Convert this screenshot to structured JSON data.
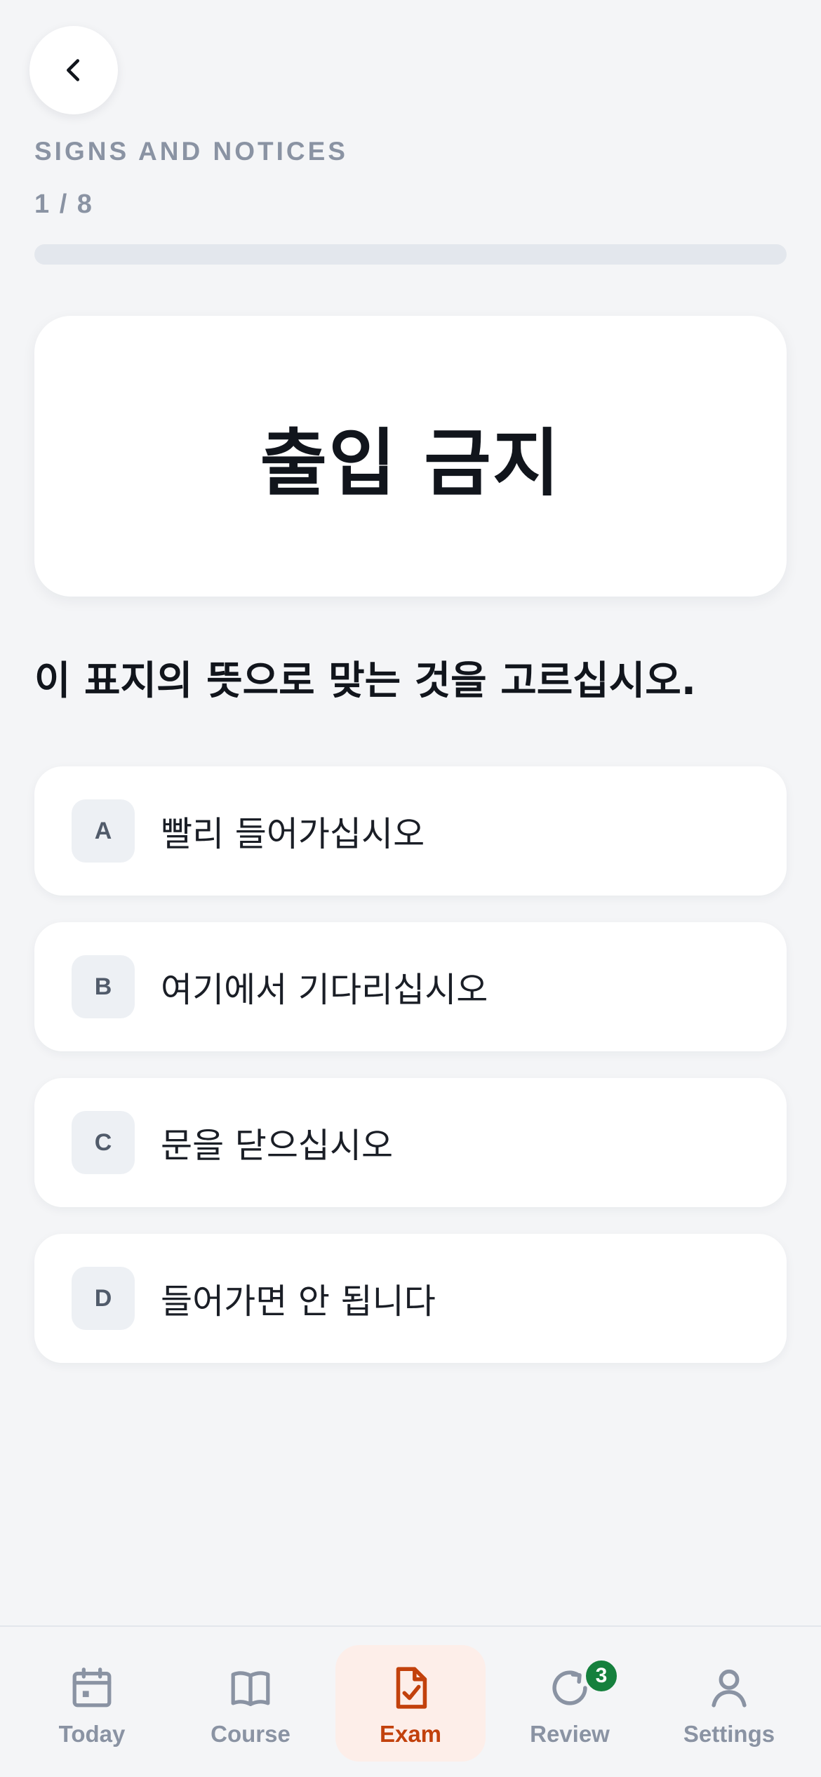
{
  "header": {
    "back_icon": "chevron-left-icon",
    "section": "SIGNS AND NOTICES",
    "counter": "1 / 8",
    "progress": 0
  },
  "sign": {
    "text": "출입 금지"
  },
  "question": "이 표지의 뜻으로 맞는 것을 고르십시오.",
  "options": [
    {
      "letter": "A",
      "text": "빨리 들어가십시오"
    },
    {
      "letter": "B",
      "text": "여기에서 기다리십시오"
    },
    {
      "letter": "C",
      "text": "문을 닫으십시오"
    },
    {
      "letter": "D",
      "text": "들어가면 안 됩니다"
    }
  ],
  "tabbar": {
    "active": "Exam",
    "accent_color": "#c2410c",
    "items": [
      {
        "label": "Today",
        "icon": "calendar-icon"
      },
      {
        "label": "Course",
        "icon": "book-icon"
      },
      {
        "label": "Exam",
        "icon": "document-check-icon"
      },
      {
        "label": "Review",
        "icon": "refresh-icon",
        "badge": "3"
      },
      {
        "label": "Settings",
        "icon": "person-icon"
      }
    ]
  }
}
